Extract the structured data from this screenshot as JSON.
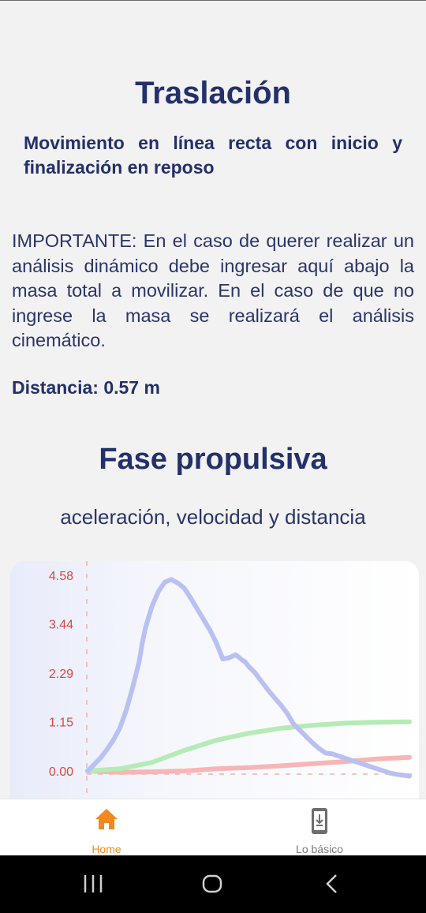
{
  "header": {
    "title": "Traslación",
    "subtitle": "Movimiento en línea recta con inicio y finalización en reposo"
  },
  "notice": {
    "text": "IMPORTANTE: En el caso de querer realizar un análisis dinámico debe ingresar aquí abajo la masa total a movilizar. En el caso de que no ingrese la masa se realizará el análisis cinemático."
  },
  "distance": {
    "text": "Distancia: 0.57 m"
  },
  "phase": {
    "title": "Fase propulsiva",
    "subtitle": "aceleración, velocidad y distancia"
  },
  "chart_data": {
    "type": "line",
    "y_ticks": [
      "4.58",
      "3.44",
      "2.29",
      "1.15",
      "0.00"
    ],
    "ylim": [
      0,
      4.58
    ],
    "grid": false,
    "colors": {
      "acceleration": "#b9c0f2",
      "velocity": "#b5ebb5",
      "distance": "#f7b5b5",
      "tick": "#e0453d"
    },
    "series": [
      {
        "key": "acceleration",
        "x": [
          0,
          2,
          4,
          6,
          8,
          10,
          12,
          14,
          16,
          17,
          18,
          20,
          22,
          24,
          26,
          28,
          30,
          32,
          34,
          36,
          38,
          40,
          42,
          44,
          46,
          48,
          49,
          50,
          52,
          54,
          56,
          58,
          60,
          62,
          64,
          66,
          68,
          70,
          72,
          74,
          76,
          78,
          80,
          82,
          84,
          86,
          88,
          90,
          92,
          94,
          96,
          98,
          100
        ],
        "values": [
          0.0,
          0.15,
          0.3,
          0.5,
          0.72,
          1.0,
          1.42,
          1.95,
          2.55,
          3.0,
          3.35,
          3.85,
          4.2,
          4.42,
          4.48,
          4.4,
          4.28,
          4.05,
          3.8,
          3.55,
          3.3,
          3.0,
          2.62,
          2.65,
          2.72,
          2.6,
          2.55,
          2.45,
          2.3,
          2.1,
          1.9,
          1.72,
          1.55,
          1.35,
          1.1,
          0.95,
          0.8,
          0.65,
          0.52,
          0.42,
          0.4,
          0.35,
          0.3,
          0.25,
          0.2,
          0.15,
          0.1,
          0.05,
          0.0,
          -0.05,
          -0.08,
          -0.1,
          -0.12
        ]
      },
      {
        "key": "velocity",
        "x": [
          0,
          10,
          20,
          30,
          40,
          50,
          60,
          70,
          80,
          90,
          100
        ],
        "values": [
          0.0,
          0.05,
          0.2,
          0.48,
          0.72,
          0.88,
          1.0,
          1.07,
          1.12,
          1.14,
          1.15
        ]
      },
      {
        "key": "distance",
        "x": [
          0,
          10,
          20,
          30,
          40,
          50,
          60,
          70,
          80,
          90,
          100
        ],
        "values": [
          0.0,
          -0.03,
          -0.02,
          0.0,
          0.05,
          0.08,
          0.12,
          0.17,
          0.22,
          0.28,
          0.32
        ]
      }
    ]
  },
  "navbar": {
    "items": [
      {
        "label": "Home",
        "icon": "home-icon"
      },
      {
        "label": "Lo básico",
        "icon": "phone-download-icon"
      }
    ]
  },
  "system_nav": {
    "icons": [
      "recent-apps-icon",
      "home-circle-icon",
      "back-icon"
    ]
  }
}
